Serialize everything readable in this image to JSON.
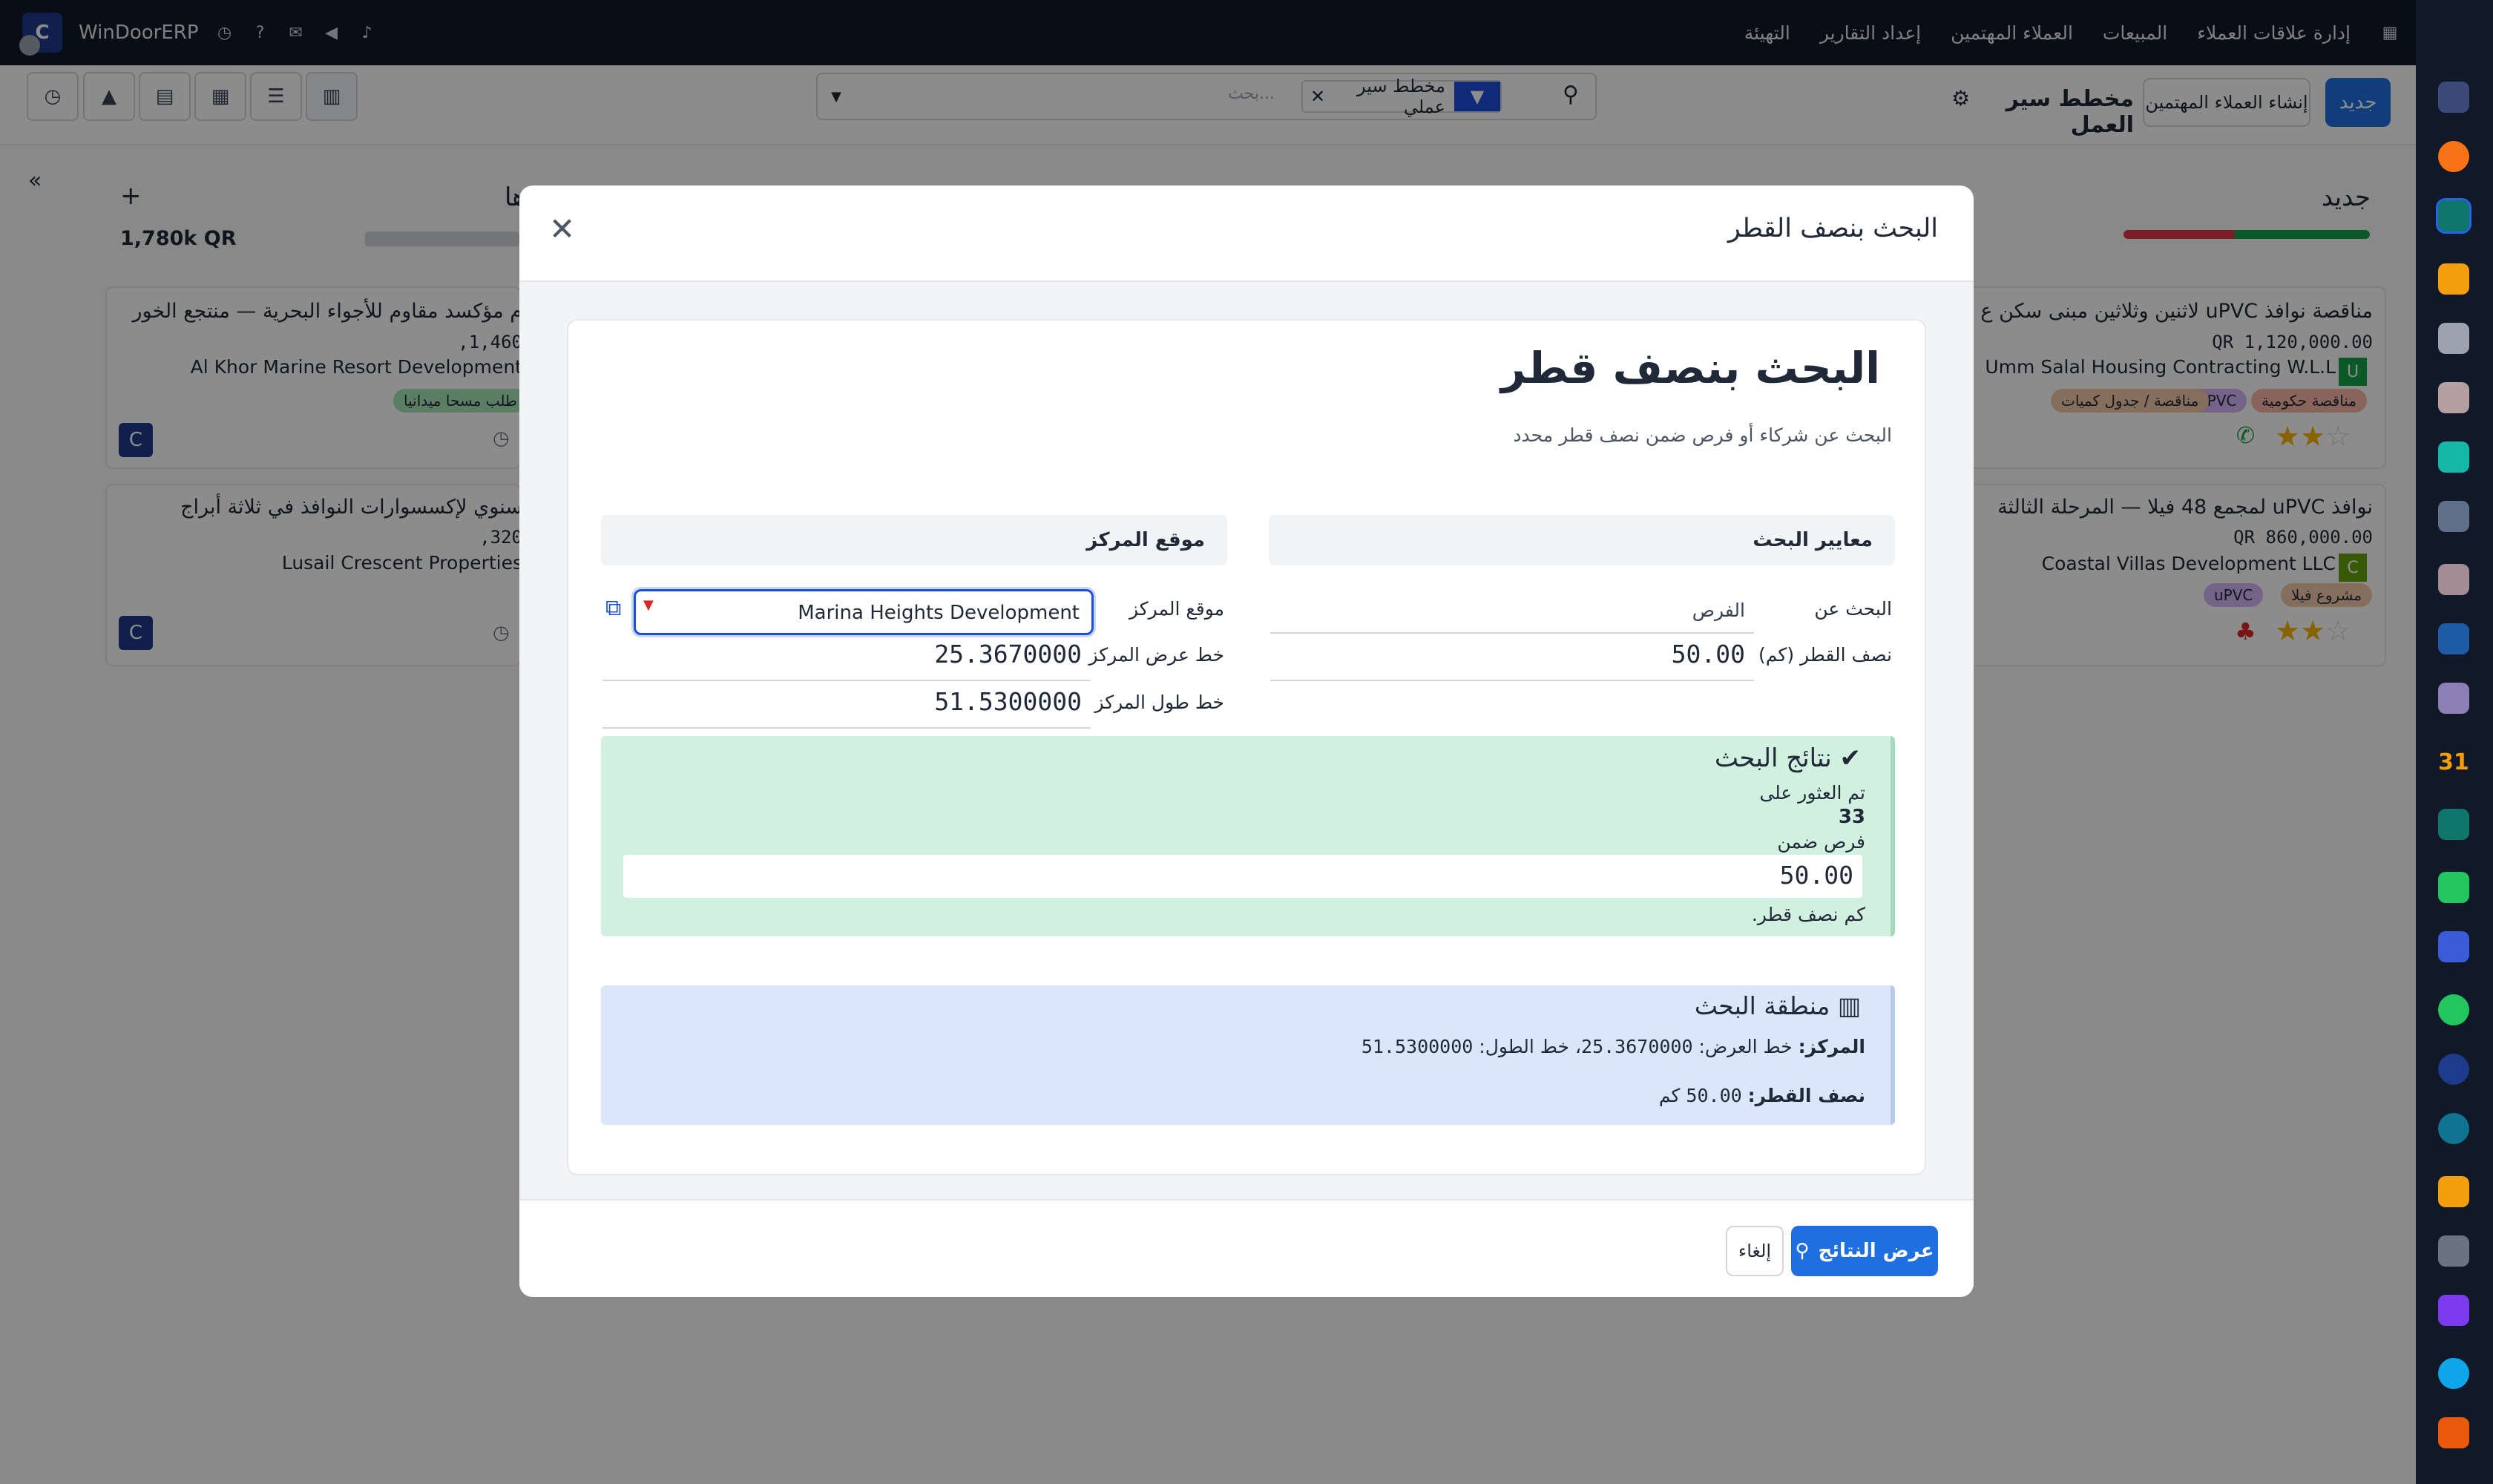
{
  "app": {
    "brand": "WinDoorERP",
    "avatar_letter": "C"
  },
  "topnav": [
    "إدارة علاقات العملاء",
    "المبيعات",
    "العملاء المهتمين",
    "إعداد التقارير",
    "التهيئة"
  ],
  "control": {
    "new_button": "جديد",
    "create_leads_button": "إنشاء العملاء المهتمين",
    "pipeline_title": "مخطط سير العمل",
    "filter_chip": "مخطط سير عملي",
    "search_placeholder": "بحث..."
  },
  "kanban": {
    "col_new": "جديد",
    "col2_title": "ها",
    "col2_total": "1,780k QR",
    "cards_right": [
      {
        "title": "مناقصة نوافذ uPVC لاثنين وثلاثين مبنى سكن ع",
        "amount": "1,120,000.00 QR",
        "company": "Umm Salal Housing Contracting W.L.L",
        "avatar": "U",
        "tags": [
          "مناقصة حكومية",
          "uPVC",
          "مناقصة / جدول كميات"
        ]
      },
      {
        "title": "نوافذ uPVC لمجمع 48 فيلا — المرحلة الثالثة",
        "amount": "860,000.00 QR",
        "company": "Coastal Villas Development LLC",
        "avatar": "C",
        "tags": [
          "مشروع فيلا",
          "uPVC"
        ]
      }
    ],
    "cards_left": [
      {
        "title": "م مؤكسد مقاوم للأجواء البحرية — منتجع الخور",
        "amount": "1,460,",
        "company": "Al Khor Marine Resort Development",
        "tag": "طلب مسحا ميدانيا"
      },
      {
        "title": "سنوي لإكسسوارات النوافذ في ثلاثة أبراج",
        "amount": "320,",
        "company": "Lusail Crescent Properties"
      }
    ]
  },
  "modal": {
    "title": "البحث بنصف القطر",
    "heading": "البحث بنصف قطر",
    "subtitle": "البحث عن شركاء أو فرص ضمن نصف قطر محدد",
    "section_criteria": "معايير البحث",
    "section_center": "موقع المركز",
    "search_for_label": "البحث عن",
    "search_for_value": "الفرص",
    "radius_label": "نصف القطر (كم)",
    "radius_value": "50.00",
    "center_location_label": "موقع المركز",
    "center_location_value": "Marina Heights Development",
    "center_lat_label": "خط عرض المركز",
    "center_lat_value": "25.3670000",
    "center_lng_label": "خط طول المركز",
    "center_lng_value": "51.5300000",
    "results_title": "نتائج البحث",
    "results_found": "تم العثور على",
    "results_count": "33",
    "results_within": "فرص ضمن",
    "results_radius": "50.00",
    "results_km": "كم نصف قطر.",
    "area_title": "منطقة البحث",
    "area_center_label": "المركز:",
    "area_lat_prefix": "خط العرض:",
    "area_lat": "25.3670000",
    "area_lng_prefix": "خط الطول:",
    "area_lng": "51.5300000",
    "area_radius_label": "نصف القطر:",
    "area_radius": "50.00",
    "area_km": "كم",
    "show_results_button": "عرض النتائج",
    "cancel_button": "إلغاء"
  }
}
